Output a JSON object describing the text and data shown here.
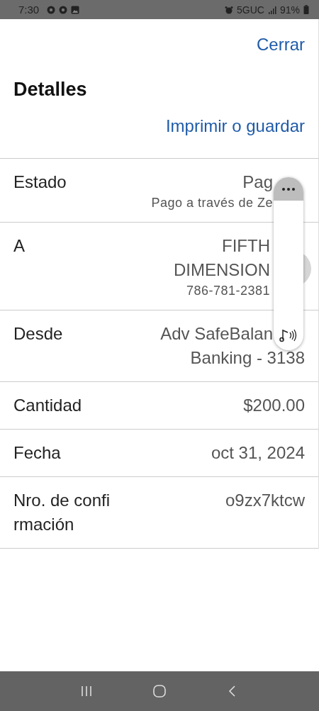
{
  "status_bar": {
    "time": "7:30",
    "network": "5GUC",
    "battery": "91%"
  },
  "header": {
    "close": "Cerrar",
    "title": "Detalles",
    "print": "Imprimir o guardar"
  },
  "rows": [
    {
      "label": "Estado",
      "lines": [
        {
          "text": "Pag",
          "covered": true
        }
      ],
      "note": {
        "text": "Pago a través de Ze",
        "covered": true
      }
    },
    {
      "label": "A",
      "lines": [
        {
          "text": "FIFTH"
        },
        {
          "text": "DIMENSION"
        }
      ],
      "note": {
        "text": "786-781-2381"
      },
      "avatar": true
    },
    {
      "label": "Desde",
      "lines": [
        {
          "text": "Adv SafeBalan",
          "covered": true
        },
        {
          "text": "Banking - 3138"
        }
      ]
    },
    {
      "label": "Cantidad",
      "lines": [
        {
          "text": "$200.00"
        }
      ]
    },
    {
      "label": "Fecha",
      "lines": [
        {
          "text": "oct 31, 2024"
        }
      ]
    },
    {
      "label": "Nro. de confi rmación",
      "lines": [
        {
          "text": "o9zx7ktcw"
        }
      ]
    }
  ]
}
